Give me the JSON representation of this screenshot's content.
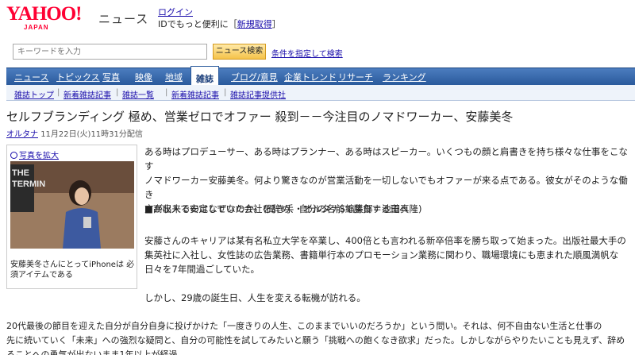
{
  "header": {
    "logo_main": "YAHOO!",
    "logo_sub": "JAPAN",
    "service_name": "ニュース",
    "login_label": "ログイン",
    "login_prompt": "IDでもっと便利に［",
    "register_label": "新規取得",
    "register_suffix": "］"
  },
  "search": {
    "placeholder": "キーワードを入力",
    "button_label": "ニュース検索",
    "advanced_label": "条件を指定して検索"
  },
  "nav": {
    "items": [
      "ニュース",
      "トピックス",
      "写真",
      "映像",
      "地域",
      "雑誌",
      "ブログ/意見",
      "企業トレンド",
      "リサーチ",
      "ランキング"
    ],
    "active": "雑誌"
  },
  "subnav": {
    "items": [
      "雑誌トップ",
      "新着雑誌記事",
      "雑誌一覧",
      "新着雑誌記事",
      "雑誌記事提供社"
    ]
  },
  "article": {
    "title": "セルフブランディング 極め、営業ゼロでオファー 殺到－－今注目のノマドワーカー、安藤美冬",
    "source": "オルタナ",
    "date": "11月22日(火)11時31分配信",
    "photo_enlarge": "写真を拡大",
    "photo_caption": "安藤美冬さんにとってiPhoneは 必須アイテムである",
    "paragraphs": [
      [
        "ある時はプロデューサー、ある時はプランナー、ある時はスピーカー。いくつもの顔と肩書きを持ち様々な仕事をこなす",
        "ノマドワーカー安藤美冬。何より驚きなのが営業活動を一切しないでもオファーが来る点である。彼女がそのような働き",
        "方が出来るのはなぜなのか。(聞き手・オルタナS編集部＝池田真隆)"
      ],
      [
        "■高収入で安定していた会社を辞め、自分の名前で勝負する道へ"
      ],
      [
        "安藤さんのキャリアは某有名私立大学を卒業し、400倍とも言われる新卒倍率を勝ち取って始まった。出版社最大手の",
        "集英社に入社し、女性誌の広告業務、書籍単行本のプロモーション業務に関わり、職場環境にも恵まれた順風満帆な",
        "日々を7年間過ごしていた。"
      ],
      [
        "しかし、29歳の誕生日、人生を変える転機が訪れる。"
      ],
      [
        "20代最後の節目を迎えた自分が自分自身に投げかけた「一度きりの人生、このままでいいのだろうか」という問い。それは、何不自由ない生活と仕事の",
        "先に続いていく「未来」への強烈な疑問と、自分の可能性を試してみたいと願う「挑戦への飽くなき欲求」だった。しかしながらやりたいことも見えず、辞め",
        "ることへの勇気が出ないまま1年以上が経過"
      ]
    ]
  },
  "colors": {
    "brand_red": "#ff0033",
    "nav_blue": "#2a5a9c",
    "link_blue": "#1a0dab"
  }
}
